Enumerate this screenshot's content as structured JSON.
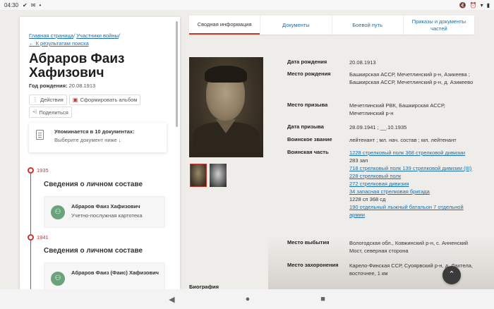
{
  "status_bar": {
    "time": "04:30",
    "icons": [
      "check-icon",
      "mail-icon",
      "dot-icon"
    ],
    "right_icons": [
      "mute-icon",
      "alarm-icon",
      "wifi-icon",
      "battery-icon"
    ]
  },
  "breadcrumbs": {
    "home": "Главная страница",
    "participants": "Участники войны",
    "back": "← К результатам поиска"
  },
  "person": {
    "name": "Абраров Фаиз Хафизович",
    "birth_label": "Год рождения:",
    "birth_value": "20.08.1913"
  },
  "actions": {
    "actions_label": "Действия",
    "album_label": "Сформировать альбом",
    "share_label": "Поделиться"
  },
  "mentions": {
    "title": "Упоминается в 10 документах:",
    "subtitle": "Выберите документ ниже ↓"
  },
  "timeline": [
    {
      "year": "1935",
      "section": "Сведения о личном составе",
      "person": "Абраров Фаиз Хафизович",
      "doc": "Учетно-послужная картотека"
    },
    {
      "year": "1941",
      "section": "Сведения о личном составе",
      "person": "Абраров Фаиз (Фаис) Хафизович",
      "doc": ""
    }
  ],
  "tabs": [
    {
      "label": "Сводная информация",
      "active": true
    },
    {
      "label": "Документы",
      "active": false
    },
    {
      "label": "Боевой путь",
      "active": false
    },
    {
      "label": "Приказы и документы частей",
      "active": false
    }
  ],
  "details": {
    "birth_date": {
      "label": "Дата рождения",
      "value": "20.08.1913"
    },
    "birth_place": {
      "label": "Место рождения",
      "value": "Башкирская АССР, Мечетлинский р-н, Азикеева ; Башкирская АССР, Мечетлинский р-н, д. Азикеево"
    },
    "draft_place": {
      "label": "Место призыва",
      "value": "Мечетлинский РВК, Башкирская АССР, Мечетлинский р-н"
    },
    "draft_date": {
      "label": "Дата призыва",
      "value": "28.09.1941 ; __.10.1935"
    },
    "rank": {
      "label": "Воинское звание",
      "value": "лейтенант ; мл. нач. состав ; мл. лейтенант"
    },
    "unit": {
      "label": "Воинская часть",
      "items": [
        {
          "text": "1228 стрелковый полк 368 стрелковой дивизии",
          "link": true
        },
        {
          "text": "283 зап",
          "link": false
        },
        {
          "text": "718 стрелковый полк 139 стрелковой дивизии (III)",
          "link": true
        },
        {
          "text": "228 стрелковый полк",
          "link": true
        },
        {
          "text": "272 стрелковая дивизия",
          "link": true
        },
        {
          "text": "34 запасная стрелковая бригада",
          "link": true
        },
        {
          "text": "1228 сп 368 сд",
          "link": false
        },
        {
          "text": "190 отдельный лыжный батальон 7 отдельной армии",
          "link": true
        }
      ]
    },
    "departure_place": {
      "label": "Место выбытия",
      "value": "Вологодская обл., Ковжинский р-н, с. Анненский Мост, северная сторона"
    },
    "burial_place": {
      "label": "Место захоронения",
      "value": "Карело-Финская ССР, Суоярвский р-н, д. Лахтела, восточнее, 1 км"
    }
  },
  "bio_heading": "Биография",
  "colors": {
    "accent": "#c0392b",
    "link": "#1b6ea8",
    "avatar": "#6aa37a"
  }
}
